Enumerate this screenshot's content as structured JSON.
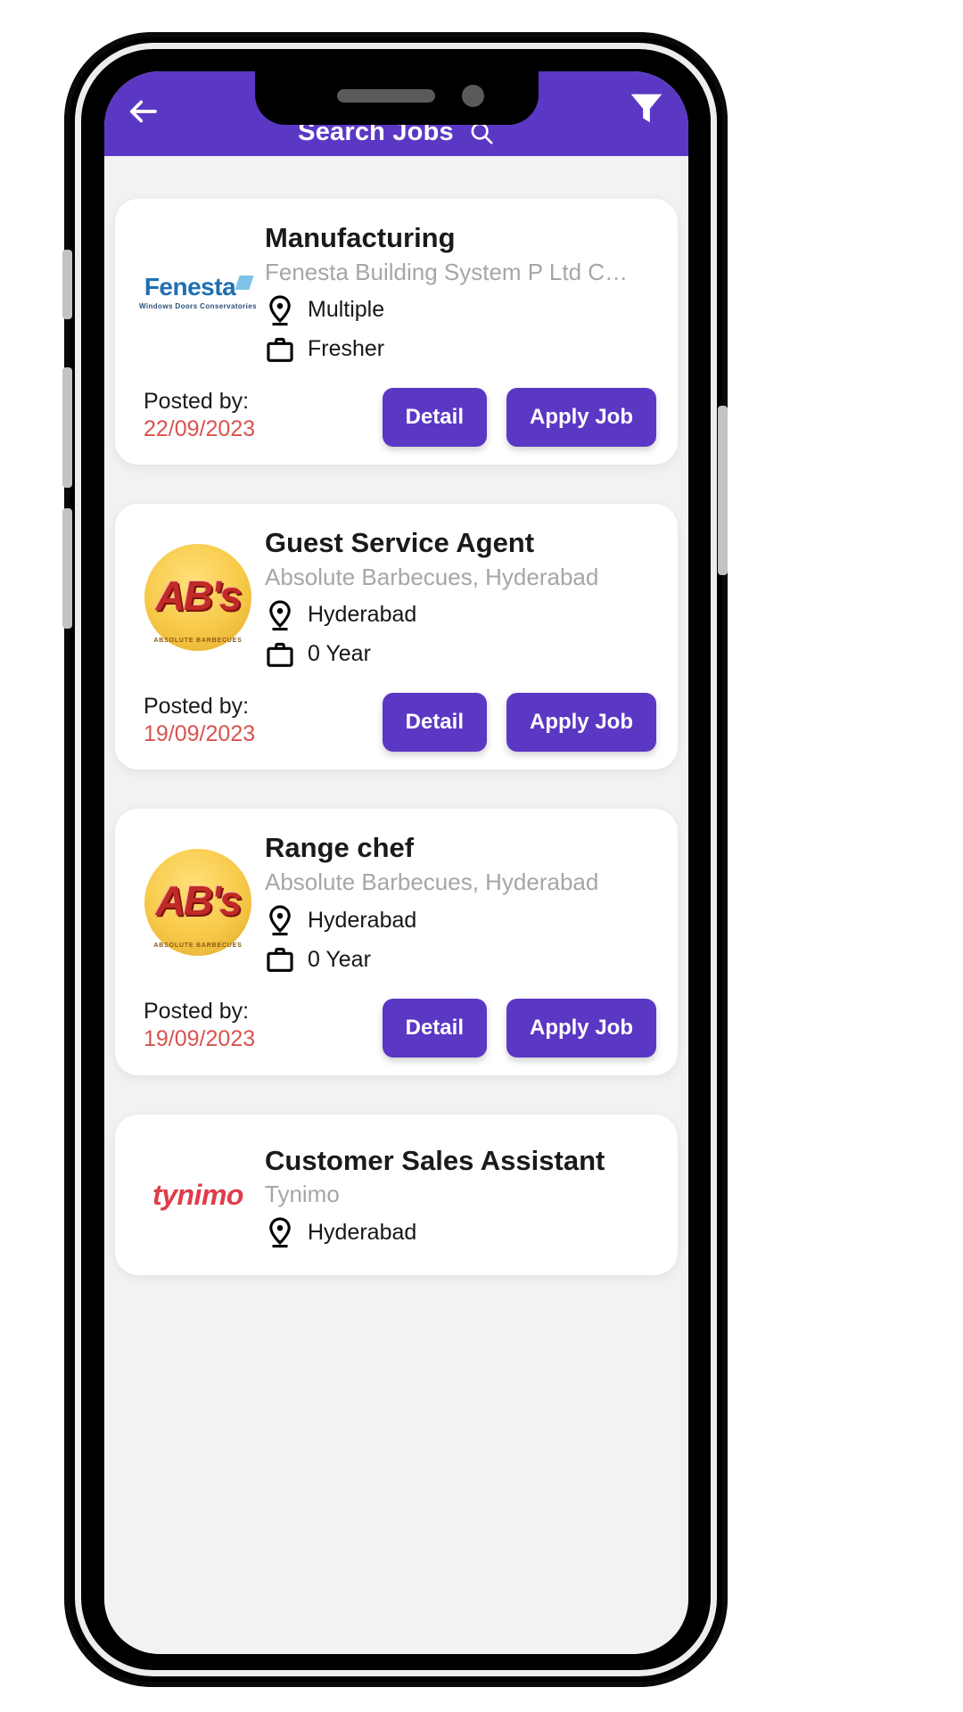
{
  "app": {
    "header": {
      "title": "Search Jobs",
      "back_icon": "arrow-left-icon",
      "search_icon": "search-icon",
      "filter_icon": "filter-funnel-icon",
      "bar_color": "#5b38c4"
    },
    "colors": {
      "accent": "#5b38c4",
      "date_red": "#d9534f",
      "company_grey": "#a6a6a6",
      "page_bg": "#f2f2f4",
      "card_bg": "#ffffff"
    },
    "labels": {
      "posted_by": "Posted by:",
      "detail_button": "Detail",
      "apply_button": "Apply Job"
    },
    "jobs": [
      {
        "title": "Manufacturing",
        "company": "Fenesta Building System P Ltd C…",
        "location": "Multiple",
        "experience": "Fresher",
        "posted_label": "Posted by:",
        "posted_date": "22/09/2023",
        "detail_label": "Detail",
        "apply_label": "Apply Job",
        "logo": {
          "kind": "fenesta",
          "word": "Fenesta",
          "tagline": "Windows Doors Conservatories"
        }
      },
      {
        "title": "Guest Service Agent",
        "company": "Absolute Barbecues, Hyderabad",
        "location": "Hyderabad",
        "experience": "0 Year",
        "posted_label": "Posted by:",
        "posted_date": "19/09/2023",
        "detail_label": "Detail",
        "apply_label": "Apply Job",
        "logo": {
          "kind": "abs",
          "word": "AB's",
          "tagline": "ABSOLUTE BARBECUES"
        }
      },
      {
        "title": "Range chef",
        "company": "Absolute Barbecues, Hyderabad",
        "location": "Hyderabad",
        "experience": "0 Year",
        "posted_label": "Posted by:",
        "posted_date": "19/09/2023",
        "detail_label": "Detail",
        "apply_label": "Apply Job",
        "logo": {
          "kind": "abs",
          "word": "AB's",
          "tagline": "ABSOLUTE BARBECUES"
        }
      },
      {
        "title": "Customer Sales Assistant",
        "company": "Tynimo",
        "location": "Hyderabad",
        "experience": "",
        "posted_label": "",
        "posted_date": "",
        "detail_label": "",
        "apply_label": "",
        "logo": {
          "kind": "tynimo",
          "word": "tynimo",
          "tagline": ""
        }
      }
    ]
  }
}
